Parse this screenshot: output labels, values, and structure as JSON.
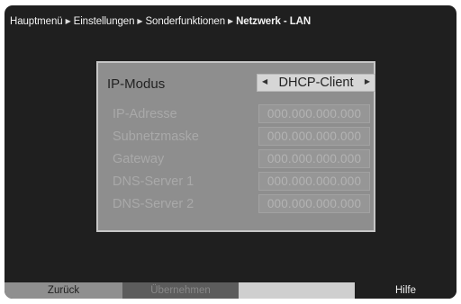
{
  "breadcrumb": {
    "items": [
      "Hauptmenü",
      "Einstellungen",
      "Sonderfunktionen"
    ],
    "current": "Netzwerk - LAN",
    "separator_icon": "triangle-right-icon"
  },
  "mode": {
    "label": "IP-Modus",
    "value": "DHCP-Client",
    "left_icon": "arrow-left-icon",
    "right_icon": "arrow-right-icon"
  },
  "fields": [
    {
      "label": "IP-Adresse",
      "value": "000.000.000.000"
    },
    {
      "label": "Subnetzmaske",
      "value": "000.000.000.000"
    },
    {
      "label": "Gateway",
      "value": "000.000.000.000"
    },
    {
      "label": "DNS-Server 1",
      "value": "000.000.000.000"
    },
    {
      "label": "DNS-Server 2",
      "value": "000.000.000.000"
    }
  ],
  "footer": {
    "back": "Zurück",
    "apply": "Übernehmen",
    "blank": "",
    "help": "Hilfe"
  },
  "colors": {
    "background": "#1f1f1f",
    "panel": "#8e8e8e",
    "disabled_text": "#a9a9a9",
    "footer_back": "#8f8f8f",
    "footer_apply": "#5c5c5c",
    "footer_blank": "#cfcfcf"
  }
}
